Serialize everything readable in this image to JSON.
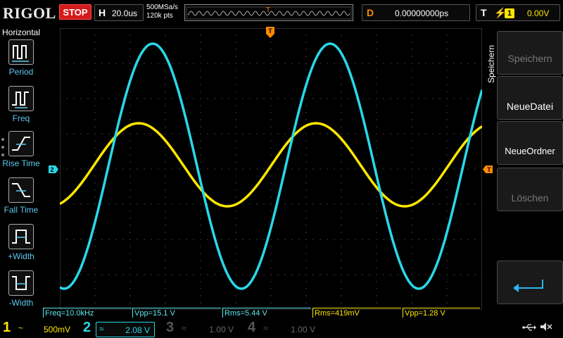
{
  "brand": "RIGOL",
  "run_state": "STOP",
  "horizontal": {
    "label": "H",
    "timebase": "20.0us"
  },
  "acquisition": {
    "sample_rate": "500MSa/s",
    "memory_depth": "120k pts"
  },
  "memory_map": {
    "trigger_marker": "T"
  },
  "delay": {
    "label": "D",
    "value": "0.00000000ps"
  },
  "trigger": {
    "label": "T",
    "edge": "⚡",
    "source": "1",
    "level": "0.00V"
  },
  "left_menu": {
    "title": "Horizontal",
    "items": [
      {
        "label": "Period",
        "icon": "period-icon"
      },
      {
        "label": "Freq",
        "icon": "freq-icon"
      },
      {
        "label": "Rise Time",
        "icon": "rise-time-icon"
      },
      {
        "label": "Fall Time",
        "icon": "fall-time-icon"
      },
      {
        "label": "+Width",
        "icon": "positive-width-icon"
      },
      {
        "label": "-Width",
        "icon": "negative-width-icon"
      }
    ]
  },
  "markers": {
    "ch2_offset": "2",
    "trigger_pos": "T",
    "trigger_level": "T"
  },
  "right_menu": {
    "title": "Speichern",
    "buttons": [
      {
        "label": "Speichern",
        "enabled": false
      },
      {
        "label": "NeueDatei",
        "enabled": true
      },
      {
        "label": "NeueOrdner",
        "enabled": true
      },
      {
        "label": "Löschen",
        "enabled": false
      }
    ],
    "enter_icon": "enter-return-icon"
  },
  "measurements": [
    {
      "text": "Freq=10.0kHz",
      "color": "#5ee8f0"
    },
    {
      "text": "Vpp=15.1 V",
      "color": "#5ee8f0"
    },
    {
      "text": "Rms=5.44 V",
      "color": "#5ee8f0"
    },
    {
      "text": "Rms=419mV",
      "color": "#ffe600"
    },
    {
      "text": "Vpp=1.28 V",
      "color": "#ffe600"
    }
  ],
  "channels": [
    {
      "number": "1",
      "coupling": "~",
      "scale": "500mV",
      "color": "#ffe600",
      "active": true
    },
    {
      "number": "2",
      "coupling": "≈",
      "scale": "2.08 V",
      "color": "#29d8e8",
      "active": true
    },
    {
      "number": "3",
      "coupling": "≈",
      "scale": "1.00 V",
      "color": "#c040c0",
      "active": false
    },
    {
      "number": "4",
      "coupling": "≈",
      "scale": "1.00 V",
      "color": "#5070e0",
      "active": false
    }
  ],
  "status_icons": [
    "usb-icon",
    "speaker-muted-icon"
  ],
  "waveforms": {
    "ch1": {
      "color": "#ffe600",
      "vpp": 1.28,
      "freq_khz": 10.0
    },
    "ch2": {
      "color": "#29d8e8",
      "vpp": 15.1,
      "freq_khz": 10.0
    }
  }
}
